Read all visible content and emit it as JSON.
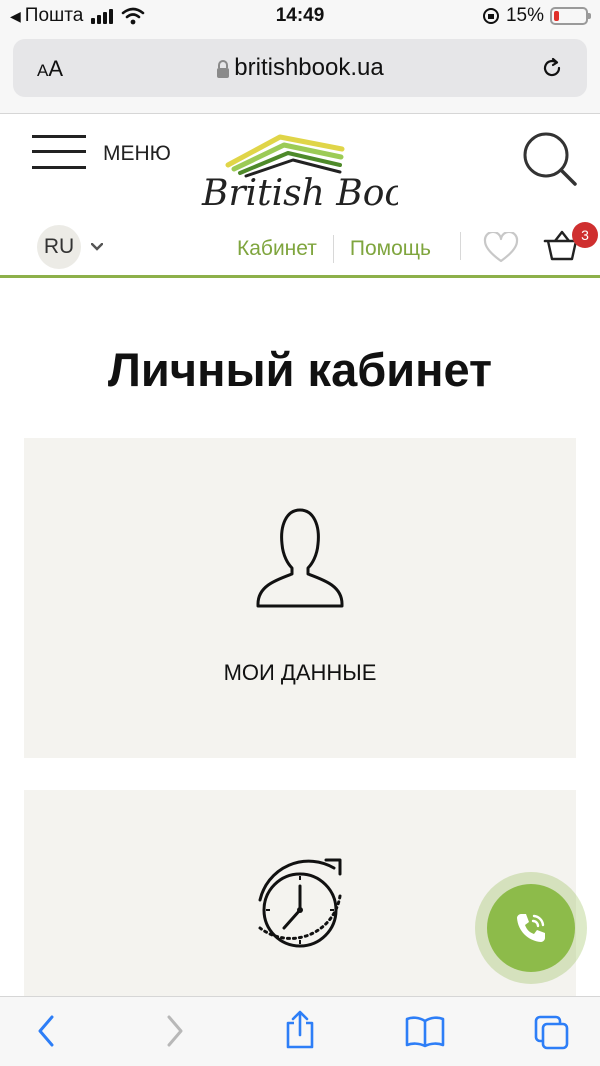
{
  "status_bar": {
    "carrier": "Пошта",
    "time": "14:49",
    "battery_percent": "15%",
    "battery_level": 0.15
  },
  "browser": {
    "text_size_small": "A",
    "text_size_large": "A",
    "url": "britishbook.ua"
  },
  "header": {
    "menu_label": "МЕНЮ",
    "logo_text": "British Book",
    "language": "RU",
    "nav": [
      "Кабинет",
      "Помощь"
    ],
    "cart_count": "3"
  },
  "main": {
    "title": "Личный кабинет",
    "cards": [
      {
        "label": "МОИ ДАННЫЕ",
        "icon": "user-icon"
      },
      {
        "label": "",
        "icon": "history-clock-icon"
      }
    ]
  },
  "colors": {
    "accent": "#8db04a",
    "link": "#7fa53e",
    "badge": "#cf2f2f",
    "card_bg": "#f4f3ef"
  }
}
